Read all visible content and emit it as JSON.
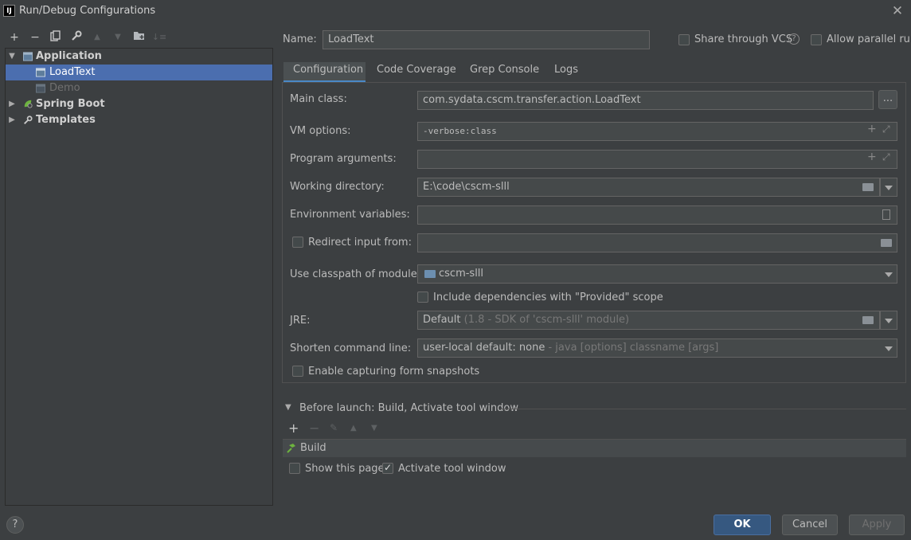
{
  "window": {
    "title": "Run/Debug Configurations",
    "app_icon": "IJ"
  },
  "tree": {
    "items": [
      {
        "label": "Application"
      },
      {
        "label": "LoadText"
      },
      {
        "label": "Demo"
      },
      {
        "label": "Spring Boot"
      },
      {
        "label": "Templates"
      }
    ]
  },
  "header": {
    "name_label": "Name:",
    "name_value": "LoadText",
    "share_label": "Share through VCS",
    "parallel_label": "Allow parallel run"
  },
  "tabs": [
    "Configuration",
    "Code Coverage",
    "Grep Console",
    "Logs"
  ],
  "form": {
    "main_class_label": "Main class:",
    "main_class_value": "com.sydata.cscm.transfer.action.LoadText",
    "browse_label": "...",
    "vm_label": "VM options:",
    "vm_value": "-verbose:class",
    "args_label": "Program arguments:",
    "args_value": "",
    "workdir_label": "Working directory:",
    "workdir_value": "E:\\code\\cscm-slll",
    "env_label": "Environment variables:",
    "env_value": "",
    "redirect_label": "Redirect input from:",
    "module_label": "Use classpath of module:",
    "module_value": "cscm-slll",
    "include_deps_label": "Include dependencies with \"Provided\" scope",
    "jre_label": "JRE:",
    "jre_value": "Default",
    "jre_hint": "(1.8 - SDK of 'cscm-slll' module)",
    "shorten_label": "Shorten command line:",
    "shorten_value": "user-local default: none",
    "shorten_hint": "- java [options] classname [args]",
    "snapshots_label": "Enable capturing form snapshots"
  },
  "before_launch": {
    "title": "Before launch: Build, Activate tool window",
    "task": "Build",
    "show_page_label": "Show this page",
    "activate_label": "Activate tool window",
    "activate_checked": true
  },
  "footer": {
    "help": "?",
    "ok": "OK",
    "cancel": "Cancel",
    "apply": "Apply"
  },
  "colors": {
    "background": "#3c3f41",
    "selection": "#4b6eaf",
    "accent": "#4a88c7",
    "ok_button": "#365880"
  }
}
